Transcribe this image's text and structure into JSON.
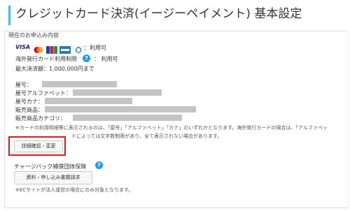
{
  "page": {
    "title": "クレジットカード決済(イージーペイメント) 基本設定"
  },
  "section": {
    "title": "現在のお申込み内容",
    "card_brands": [
      "VISA",
      "Mastercard",
      "JCB",
      "American Express",
      "Diners Club"
    ],
    "brands_status": "：利用可",
    "overseas_label": "海外発行カード利用制限",
    "overseas_status": "： 利用可",
    "max_amount": "最大決済額：1,000,000円まで"
  },
  "fields": [
    {
      "label": "屋号："
    },
    {
      "label": "屋号アルファベット："
    },
    {
      "label": "屋号カナ："
    },
    {
      "label": "販売商品："
    },
    {
      "label": "販売商品カテゴリ："
    }
  ],
  "notes": {
    "line1": "※カードの利用明細等に表示されるのは、「屋号」「アルファベット」「カナ」のいずれかとなります。海外発行カードの場合は、「アルファベッ",
    "line2": "ドによっては文字数制限があり、全て表示されない場合があります。"
  },
  "buttons": {
    "detail": "詳細確認・変更",
    "docs": "資料・申し込み書類請求"
  },
  "chargeback": {
    "title": "チャージバック補償団体保険",
    "note": "※ECサイトが法人運営の場合にのみ対象となります。"
  },
  "colors": {
    "accent": "#4db6e6",
    "help_icon": "#1e9be9",
    "highlight": "#e0191f"
  }
}
